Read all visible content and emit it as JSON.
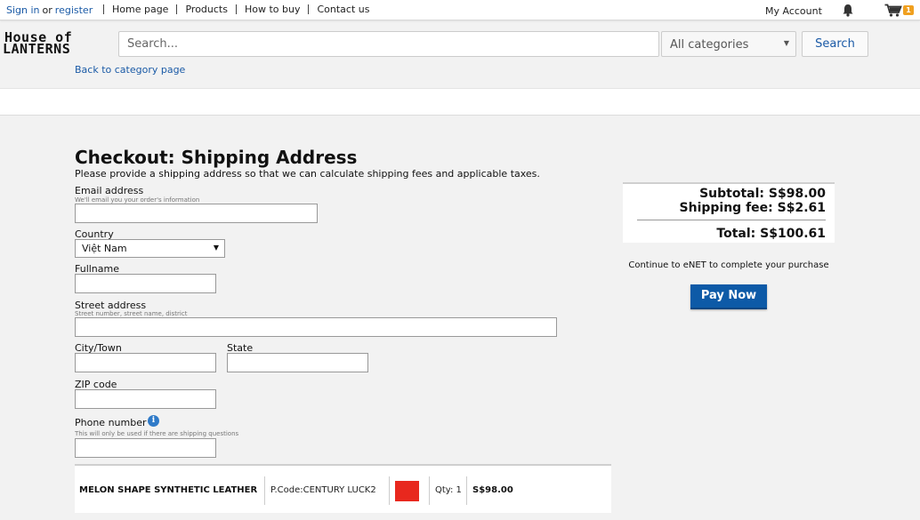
{
  "topbar": {
    "sign_in": "Sign in",
    "or": "or",
    "register": "register",
    "nav": [
      "Home page",
      "Products",
      "How to buy",
      "Contact us"
    ],
    "my_account": "My Account",
    "cart_count": "1"
  },
  "header": {
    "logo_line1": "House of",
    "logo_line2": "LANTERNS",
    "search_placeholder": "Search...",
    "category_selected": "All categories",
    "search_button": "Search",
    "back_link": "Back to category page"
  },
  "form": {
    "title": "Checkout: Shipping Address",
    "subtitle": "Please provide a shipping address so that we can calculate shipping fees and applicable taxes.",
    "email_label": "Email address",
    "email_hint": "We'll email you your order's information",
    "email_value": "",
    "country_label": "Country",
    "country_value": "Việt Nam",
    "fullname_label": "Fullname",
    "fullname_value": "",
    "street_label": "Street address",
    "street_hint": "Street number, street name, district",
    "street_value": "",
    "city_label": "City/Town",
    "city_value": "",
    "state_label": "State",
    "state_value": "",
    "zip_label": "ZIP code",
    "zip_value": "",
    "phone_label": "Phone number",
    "phone_hint": "This will only be used if there are shipping questions",
    "phone_value": ""
  },
  "order_item": {
    "name": "MELON SHAPE SYNTHETIC LEATHER",
    "code": "P.Code:CENTURY LUCK2",
    "color": "#e8281e",
    "qty": "Qty: 1",
    "price": "S$98.00"
  },
  "summary": {
    "subtotal": "Subtotal: S$98.00",
    "shipping": "Shipping fee: S$2.61",
    "total": "Total: S$100.61",
    "continue_text": "Continue to eNET to complete your purchase",
    "pay_button": "Pay Now"
  },
  "colors": {
    "link": "#1a5aa6",
    "pay_button": "#0d5aa7",
    "badge": "#f0a020"
  }
}
